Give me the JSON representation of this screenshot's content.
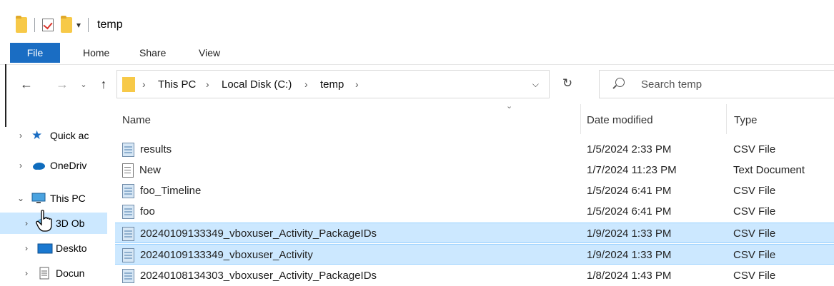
{
  "window": {
    "title": "temp"
  },
  "ribbon": {
    "tabs": [
      "File",
      "Home",
      "Share",
      "View"
    ]
  },
  "address": {
    "crumbs": [
      "This PC",
      "Local Disk (C:)",
      "temp"
    ]
  },
  "search": {
    "placeholder": "Search temp"
  },
  "nav_pane": [
    {
      "label": "Quick ac",
      "icon": "star-icon",
      "selected": false
    },
    {
      "label": "OneDriv",
      "icon": "cloud-icon",
      "selected": false
    },
    {
      "label": "This PC",
      "icon": "monitor-icon",
      "selected": false
    },
    {
      "label": "3D Ob",
      "icon": "cube-icon",
      "selected": true
    },
    {
      "label": "Deskto",
      "icon": "desktop-icon",
      "selected": false
    },
    {
      "label": "Docun",
      "icon": "document-icon",
      "selected": false
    }
  ],
  "columns": {
    "name": "Name",
    "date": "Date modified",
    "type": "Type"
  },
  "files": [
    {
      "name": "results",
      "date": "1/5/2024 2:33 PM",
      "type": "CSV File",
      "icon": "csv-file-icon",
      "selected": false
    },
    {
      "name": "New",
      "date": "1/7/2024 11:23 PM",
      "type": "Text Document",
      "icon": "text-file-icon",
      "selected": false
    },
    {
      "name": "foo_Timeline",
      "date": "1/5/2024 6:41 PM",
      "type": "CSV File",
      "icon": "csv-file-icon",
      "selected": false
    },
    {
      "name": "foo",
      "date": "1/5/2024 6:41 PM",
      "type": "CSV File",
      "icon": "csv-file-icon",
      "selected": false
    },
    {
      "name": "20240109133349_vboxuser_Activity_PackageIDs",
      "date": "1/9/2024 1:33 PM",
      "type": "CSV File",
      "icon": "csv-file-icon",
      "selected": true
    },
    {
      "name": "20240109133349_vboxuser_Activity",
      "date": "1/9/2024 1:33 PM",
      "type": "CSV File",
      "icon": "csv-file-icon",
      "selected": true
    },
    {
      "name": "20240108134303_vboxuser_Activity_PackageIDs",
      "date": "1/8/2024 1:43 PM",
      "type": "CSV File",
      "icon": "csv-file-icon",
      "selected": false
    }
  ],
  "colors": {
    "file_tab": "#1a6dc3",
    "selection": "#cce8ff",
    "folder": "#f7c948"
  }
}
